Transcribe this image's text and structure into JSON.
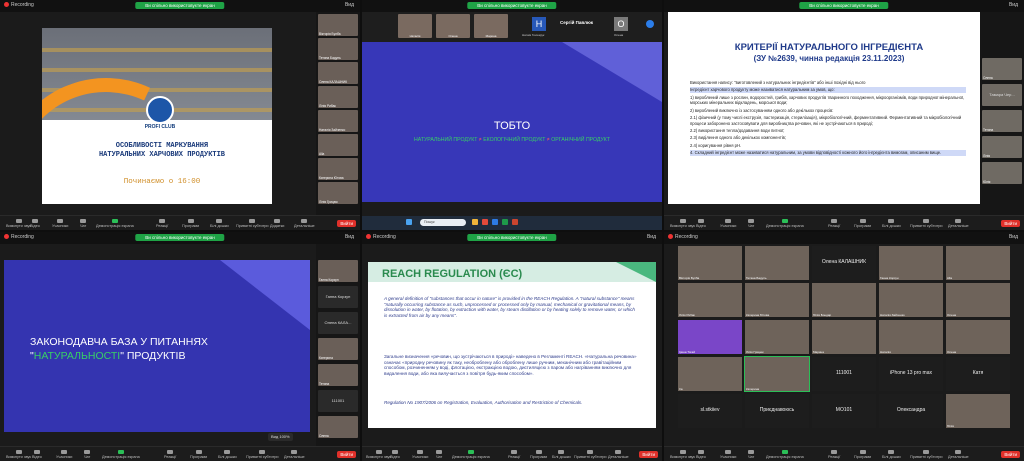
{
  "common": {
    "recording": "Recording",
    "sharing": "Ви спільно використовуєте екран",
    "view": "Вид",
    "end": "Вийти",
    "toolbar": [
      "Вимкнути звук",
      "Відео",
      "Учасники",
      "Чат",
      "Демонстрація екрана",
      "Запис",
      "Реакції",
      "Програми",
      "Білі дошки",
      "Приватні субтитри",
      "Додатки",
      "Детальніше"
    ]
  },
  "p1": {
    "brand": "PROFI CLUB",
    "title_line1": "ОСОБЛИВОСТІ МАРКУВАННЯ",
    "title_line2": "НАТУРАЛЬНИХ ХАРЧОВИХ ПРОДУКТІВ",
    "start": "Починаємо о 16:00",
    "side": [
      "Вікторія Булба",
      "Тетяна Бадуль",
      "Олена КАЛАШНИК",
      "Лілія Рибак",
      "Наталія Зайченко",
      "Alla",
      "Катерина Ютова",
      "Лілія Грицюк"
    ]
  },
  "p2": {
    "strip": [
      "Наталія",
      "Олена",
      "Марина",
      "Натаія Гончарук",
      "Сергій Павлюк",
      "Олена"
    ],
    "center_name": "Сергій Павлюк",
    "slide_title": "ТОБТО",
    "s_natural": "НАТУРАЛЬНИЙ ПРОДУКТ",
    "s_eco": "ЕКОЛОГІЧНИЙ ПРОДУКТ",
    "s_organic": "ОРГАНІЧНИЙ ПРОДУКТ",
    "neq": "≠",
    "search": "Пошук"
  },
  "p3": {
    "title": "КРИТЕРІЇ НАТУРАЛЬНОГО ІНГРЕДІЄНТА",
    "subtitle": "(ЗУ №2639, чинна редакція 23.11.2023)",
    "paras": [
      "Використання напису: \"виготовлений з натуральних інгредієнтів\" або інші похідні від нього",
      "Інгредієнт харчового продукту може називатися натуральним за умов, що:",
      "1) вироблений лише з рослин, водоростей, грибів, харчових продуктів тваринного походження, мікроорганізмів, води природної мінеральної, морських мінеральних відкладень, морської води;",
      "2) вироблений виключно із застосуванням одного або декількох процесів:",
      "2.1) фізичний (у тому числі екструзія, пастеризація, стерилізація), мікробіологічний, ферментативний. Ферментативний та мікробіологічний процеси заборонено застосовувати для виробництва речовин, які не зустрічаються в природі;",
      "2.2) використання тепла/додавання води питної;",
      "2.3) виділення одного або декількох компонентів;",
      "2.4) коригування рівня рН.",
      "4. Складний інгредієнт може називатися натуральним, за умови відповідності кожного його інгредієнта вимогам, описаним вище."
    ],
    "side": [
      "Олена",
      "Тамара Чер...",
      "Тетяна",
      "Лілія",
      "Юлія"
    ]
  },
  "p4": {
    "line1": "ЗАКОНОДАВЧА БАЗА У ПИТАННЯХ",
    "q1": "\"",
    "accent": "НАТУРАЛЬНОСТІ",
    "q2": "\"",
    "tail": " ПРОДУКТІВ",
    "side": [
      "Ганна Корзун",
      "Олена КАЛА...",
      "Катерина",
      "Тетяна",
      "111001",
      "Олена"
    ],
    "zoom": "Вид 100%"
  },
  "p5": {
    "heading": "REACH REGULATION (ЄС)",
    "en": "A general definition of \"substances that occur in nature\" is provided in the REACH Regulation. A \"natural substance\" means \"naturally occurring substance as such, unprocessed or processed only by manual, mechanical or gravitational means, by dissolution in water, by flotation, by extraction with water, by steam distillation or by heating solely to remove water, or which is extracted from air by any means\".",
    "ua": "Загальне визначення «речовин, що зустрічаються в природі» наведено в Регламенті REACH. «Натуральна речовина» означає «природну речовину як таку, необроблену або оброблену лише ручним, механічним або гравітаційним способом, розчиненням у воді, флотацією, екстракцією водою, дистиляцією з паром або нагріванням виключно для видалення води, або яка вилучається з повітря будь-яким способом».",
    "reg": "Regulation No 1907/2006 on Registration, Evaluation, Authorisation and Restriction of Chemicals."
  },
  "p6": {
    "cells": [
      "Вікторія Булба",
      "Тетяна Бадуль",
      "Олена КАЛАШНИК",
      "Ганна Корзун",
      "Alla",
      "Лілія Рибак",
      "Катерина Ютова",
      "Юлія Бондар",
      "Наталія Зайченко",
      "Олена",
      "Ірина Тягай",
      "Лілія Грицюк",
      "Марина",
      "Наталія",
      "Олена",
      "Ira",
      "Катерина",
      "Тетяна",
      "111001",
      "iPhone 13 pro max",
      "Катя",
      "sl.stkiiev",
      "Приєднавоюсь",
      "МО101",
      "Олександра",
      "Юлія"
    ]
  }
}
